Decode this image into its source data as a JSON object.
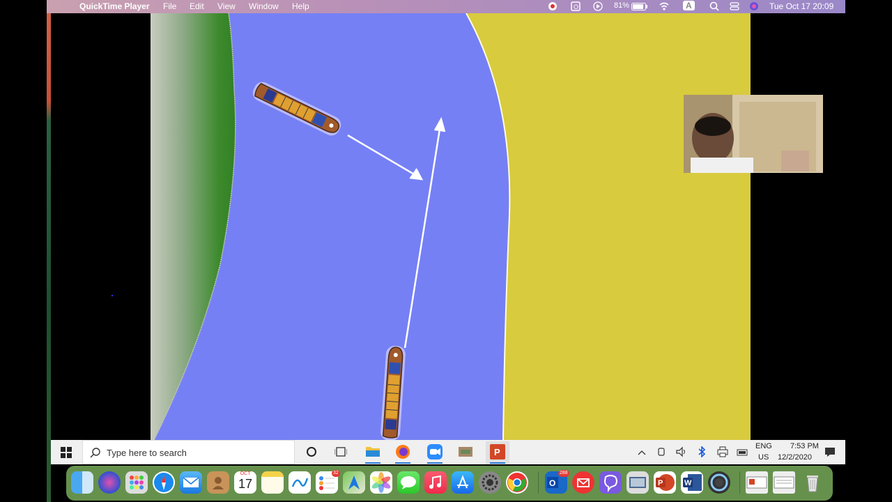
{
  "menubar": {
    "app_name": "QuickTime Player",
    "menus": [
      "File",
      "Edit",
      "View",
      "Window",
      "Help"
    ],
    "battery": "81%",
    "input_source": "A",
    "datetime": "Tue Oct 17  20:09"
  },
  "taskbar": {
    "search_placeholder": "Type here to search",
    "lang_top": "ENG",
    "lang_bottom": "US",
    "time": "7:53 PM",
    "date": "12/2/2020"
  },
  "dock": {
    "calendar_month": "OCT",
    "calendar_day": "17",
    "reminders_badge": "32",
    "outlook_badge": "288"
  },
  "colors": {
    "water": "#7580f5",
    "sand": "#d8cb3e",
    "bank": "#3a8a2a"
  }
}
